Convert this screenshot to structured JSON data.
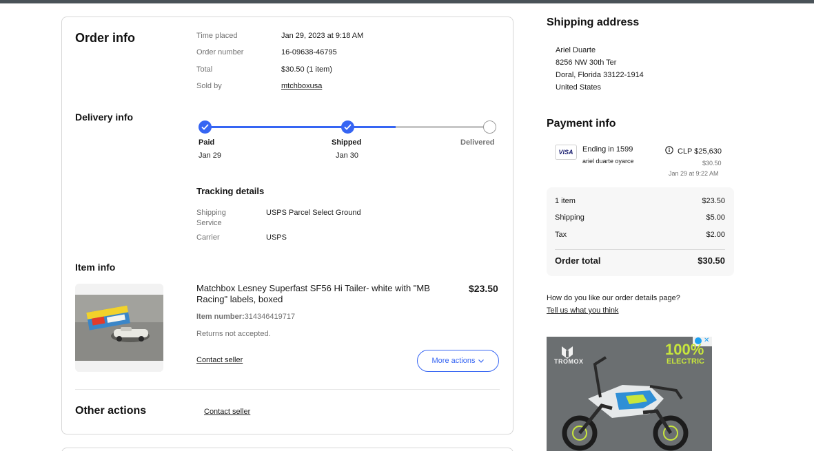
{
  "order_info": {
    "title": "Order info",
    "rows": [
      {
        "label": "Time placed",
        "value": "Jan 29, 2023 at 9:18 AM"
      },
      {
        "label": "Order number",
        "value": "16-09638-46795"
      },
      {
        "label": "Total",
        "value": "$30.50 (1 item)"
      },
      {
        "label": "Sold by",
        "value": "mtchboxusa"
      }
    ]
  },
  "delivery_info": {
    "title": "Delivery info",
    "progress_fraction": 0.67,
    "steps": [
      {
        "label": "Paid",
        "date": "Jan 29",
        "done": true
      },
      {
        "label": "Shipped",
        "date": "Jan 30",
        "done": true
      },
      {
        "label": "Delivered",
        "date": "",
        "done": false
      }
    ],
    "tracking_title": "Tracking details",
    "shipping_service_label": "Shipping Service",
    "shipping_service_value": "USPS Parcel Select Ground",
    "carrier_label": "Carrier",
    "carrier_value": "USPS"
  },
  "item_info": {
    "title": "Item info",
    "item_title": "Matchbox Lesney Superfast SF56 Hi Tailer- white with \"MB Racing\" labels, boxed",
    "price": "$23.50",
    "item_number_label": "Item number:",
    "item_number": "314346419717",
    "returns": "Returns not accepted.",
    "contact_seller": "Contact seller",
    "more_actions": "More actions"
  },
  "other_actions": {
    "title": "Other actions",
    "contact_seller": "Contact seller"
  },
  "shipping_address": {
    "title": "Shipping address",
    "lines": [
      "Ariel Duarte",
      "8256 NW 30th Ter",
      "Doral, Florida 33122-1914",
      "United States"
    ]
  },
  "payment_info": {
    "title": "Payment info",
    "card_brand": "VISA",
    "card_text": "Ending in 1599",
    "card_holder": "ariel duarte oyarce",
    "amount_clp": "CLP $25,630",
    "amount_usd": "$30.50",
    "date": "Jan 29 at 9:22 AM"
  },
  "totals": {
    "rows": [
      {
        "label": "1 item",
        "value": "$23.50"
      },
      {
        "label": "Shipping",
        "value": "$5.00"
      },
      {
        "label": "Tax",
        "value": "$2.00"
      }
    ],
    "total_label": "Order total",
    "total_value": "$30.50"
  },
  "feedback": {
    "question": "How do you like our order details page?",
    "link": "Tell us what you think"
  },
  "ad": {
    "brand": "TROMOX",
    "headline_1": "100%",
    "headline_2": "ELECTRIC"
  },
  "colors": {
    "accent": "#3665f3",
    "track": "#c7c7c7",
    "ad_green": "#c8e63c"
  }
}
